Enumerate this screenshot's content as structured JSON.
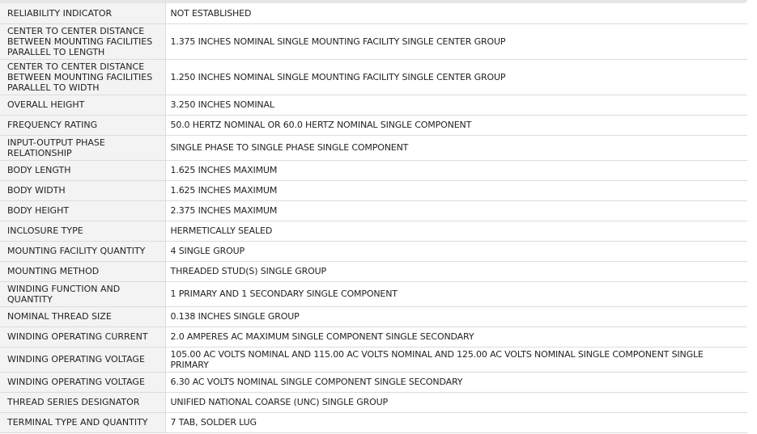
{
  "rows": [
    {
      "name": "RELIABILITY INDICATOR",
      "value": "NOT ESTABLISHED"
    },
    {
      "name": "CENTER TO CENTER DISTANCE BETWEEN MOUNTING FACILITIES PARALLEL TO LENGTH",
      "value": "1.375 INCHES NOMINAL SINGLE MOUNTING FACILITY SINGLE CENTER GROUP"
    },
    {
      "name": "CENTER TO CENTER DISTANCE BETWEEN MOUNTING FACILITIES PARALLEL TO WIDTH",
      "value": "1.250 INCHES NOMINAL SINGLE MOUNTING FACILITY SINGLE CENTER GROUP"
    },
    {
      "name": "OVERALL HEIGHT",
      "value": "3.250 INCHES NOMINAL"
    },
    {
      "name": "FREQUENCY RATING",
      "value": "50.0 HERTZ NOMINAL OR 60.0 HERTZ NOMINAL SINGLE COMPONENT"
    },
    {
      "name": "INPUT-OUTPUT PHASE RELATIONSHIP",
      "value": "SINGLE PHASE TO SINGLE PHASE SINGLE COMPONENT"
    },
    {
      "name": "BODY LENGTH",
      "value": "1.625 INCHES MAXIMUM"
    },
    {
      "name": "BODY WIDTH",
      "value": "1.625 INCHES MAXIMUM"
    },
    {
      "name": "BODY HEIGHT",
      "value": "2.375 INCHES MAXIMUM"
    },
    {
      "name": "INCLOSURE TYPE",
      "value": "HERMETICALLY SEALED"
    },
    {
      "name": "MOUNTING FACILITY QUANTITY",
      "value": "4 SINGLE GROUP"
    },
    {
      "name": "MOUNTING METHOD",
      "value": "THREADED STUD(S) SINGLE GROUP"
    },
    {
      "name": "WINDING FUNCTION AND QUANTITY",
      "value": "1 PRIMARY AND 1 SECONDARY SINGLE COMPONENT"
    },
    {
      "name": "NOMINAL THREAD SIZE",
      "value": "0.138 INCHES SINGLE GROUP"
    },
    {
      "name": "WINDING OPERATING CURRENT",
      "value": "2.0 AMPERES AC MAXIMUM SINGLE COMPONENT SINGLE SECONDARY"
    },
    {
      "name": "WINDING OPERATING VOLTAGE",
      "value": "105.00 AC VOLTS NOMINAL AND 115.00 AC VOLTS NOMINAL AND 125.00 AC VOLTS NOMINAL SINGLE COMPONENT SINGLE PRIMARY"
    },
    {
      "name": "WINDING OPERATING VOLTAGE",
      "value": "6.30 AC VOLTS NOMINAL SINGLE COMPONENT SINGLE SECONDARY"
    },
    {
      "name": "THREAD SERIES DESIGNATOR",
      "value": "UNIFIED NATIONAL COARSE (UNC) SINGLE GROUP"
    },
    {
      "name": "TERMINAL TYPE AND QUANTITY",
      "value": "7 TAB, SOLDER LUG"
    }
  ]
}
